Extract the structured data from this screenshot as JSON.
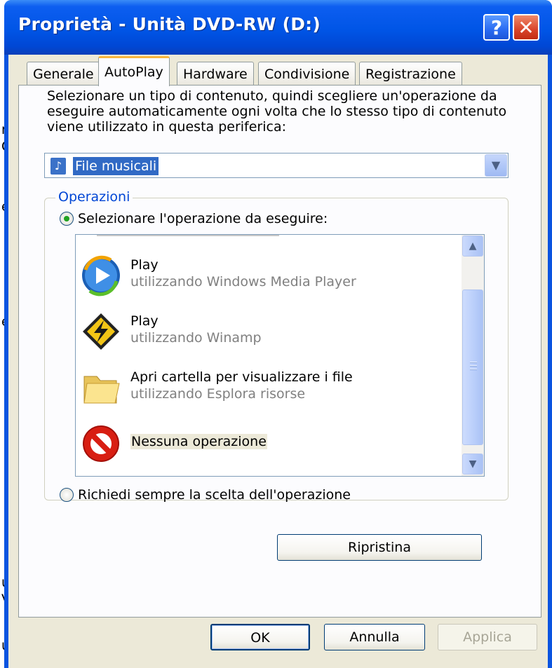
{
  "background": {
    "fragments": [
      "n",
      "O",
      "e",
      "e",
      "u",
      "V",
      "u|"
    ]
  },
  "window": {
    "title": "Proprietà - Unità DVD-RW (D:)",
    "help_label": "?",
    "close_label": "✕"
  },
  "tabs": [
    {
      "label": "Generale"
    },
    {
      "label": "AutoPlay"
    },
    {
      "label": "Hardware"
    },
    {
      "label": "Condivisione"
    },
    {
      "label": "Registrazione"
    }
  ],
  "autoplay": {
    "description_lines": [
      "Selezionare un tipo di contenuto, quindi scegliere un'operazione da",
      "eseguire automaticamente ogni volta che lo stesso tipo di contenuto",
      "viene utilizzato in questa periferica:"
    ],
    "content_type": "File musicali",
    "group_label": "Operazioni",
    "radio_select": {
      "label": "Selezionare l'operazione da eseguire:",
      "checked": true
    },
    "actions": [
      {
        "title": "Play",
        "subtitle": "utilizzando Windows Media Player",
        "icon": "windows-media-player-icon"
      },
      {
        "title": "Play",
        "subtitle": "utilizzando Winamp",
        "icon": "winamp-icon"
      },
      {
        "title": "Apri cartella per visualizzare i file",
        "subtitle": "utilizzando Esplora risorse",
        "icon": "folder-icon"
      },
      {
        "title": "Nessuna operazione",
        "subtitle": "",
        "icon": "no-action-icon",
        "selected": true
      }
    ],
    "radio_prompt": {
      "label": "Richiedi sempre la scelta dell'operazione",
      "checked": false
    },
    "restore_button": "Ripristina"
  },
  "footer": {
    "ok": "OK",
    "cancel": "Annulla",
    "apply": "Applica"
  }
}
